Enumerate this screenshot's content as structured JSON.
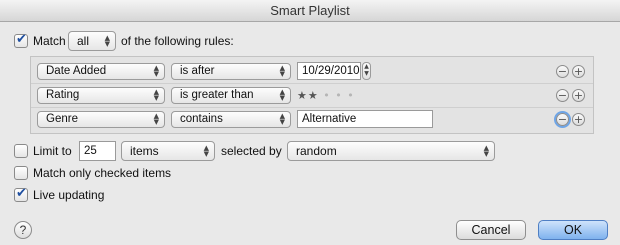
{
  "window": {
    "title": "Smart Playlist"
  },
  "match": {
    "label_prefix": "Match",
    "selected": "all",
    "label_suffix": "of the following rules:",
    "checked": true
  },
  "rules": [
    {
      "field": "Date Added",
      "operator": "is after",
      "value": "10/29/2010"
    },
    {
      "field": "Rating",
      "operator": "is greater than",
      "rating_stars": 2,
      "rating_max": 5
    },
    {
      "field": "Genre",
      "operator": "contains",
      "value": "Alternative"
    }
  ],
  "rule_buttons": {
    "remove": "−",
    "add": "+"
  },
  "limit": {
    "checked": false,
    "label": "Limit to",
    "value": "25",
    "unit": "items",
    "selected_by_label": "selected by",
    "selected_by": "random"
  },
  "match_checked": {
    "checked": false,
    "label": "Match only checked items"
  },
  "live_updating": {
    "checked": true,
    "label": "Live updating"
  },
  "buttons": {
    "help": "?",
    "cancel": "Cancel",
    "ok": "OK"
  },
  "icons": {
    "star_on": "★",
    "star_off": "•",
    "popup_arrows": "updown-chevron-icon"
  }
}
